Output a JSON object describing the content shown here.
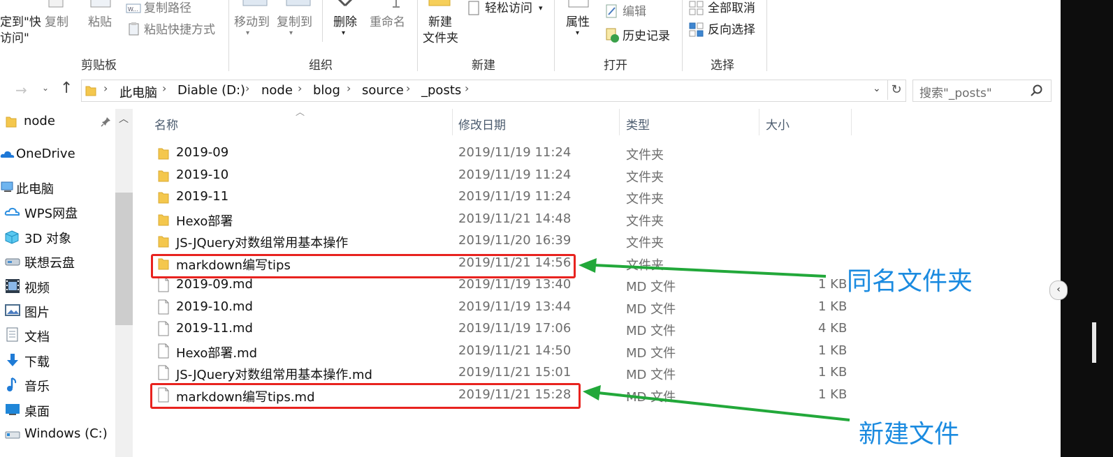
{
  "ribbon": {
    "pin_label_line1": "定到\"快",
    "pin_label_line2": "访问\"",
    "copy": "复制",
    "paste": "粘贴",
    "copy_path": "复制路径",
    "paste_shortcut": "粘贴快捷方式",
    "move_to": "移动到",
    "copy_to": "复制到",
    "delete": "删除",
    "rename": "重命名",
    "new_folder_line1": "新建",
    "new_folder_line2": "文件夹",
    "easy_access": "轻松访问",
    "properties": "属性",
    "edit": "编辑",
    "history": "历史记录",
    "select_all_none": "全部取消",
    "invert_selection": "反向选择",
    "groups": {
      "clipboard": "剪贴板",
      "organize": "组织",
      "new": "新建",
      "open": "打开",
      "select": "选择"
    }
  },
  "address": {
    "crumbs": [
      "此电脑",
      "Diable (D:)",
      "node",
      "blog",
      "source",
      "_posts"
    ],
    "search_placeholder": "搜索\"_posts\""
  },
  "nav": {
    "items": [
      {
        "label": "node",
        "icon": "folder-icon",
        "color": "#e8b93c"
      },
      {
        "label": "OneDrive",
        "icon": "cloud-icon",
        "color": "#1e78d7"
      },
      {
        "label": "此电脑",
        "icon": "computer-icon",
        "color": "#3a86c8"
      },
      {
        "label": "WPS网盘",
        "icon": "cloud-outline-icon",
        "color": "#2d8fe0"
      },
      {
        "label": "3D 对象",
        "icon": "cube-icon",
        "color": "#2aa6d8"
      },
      {
        "label": "联想云盘",
        "icon": "drive-icon",
        "color": "#5c6b7a"
      },
      {
        "label": "视频",
        "icon": "film-icon",
        "color": "#334"
      },
      {
        "label": "图片",
        "icon": "picture-icon",
        "color": "#4a6c8c"
      },
      {
        "label": "文档",
        "icon": "document-icon",
        "color": "#6b7b8b"
      },
      {
        "label": "下载",
        "icon": "download-icon",
        "color": "#1f7bd6"
      },
      {
        "label": "音乐",
        "icon": "music-icon",
        "color": "#1f7bd6"
      },
      {
        "label": "桌面",
        "icon": "desktop-icon",
        "color": "#1f86d8"
      },
      {
        "label": "Windows (C:)",
        "icon": "disk-icon",
        "color": "#7a8a9a"
      }
    ]
  },
  "list": {
    "headers": {
      "name": "名称",
      "date": "修改日期",
      "type": "类型",
      "size": "大小"
    },
    "rows": [
      {
        "name": "2019-09",
        "date": "2019/11/19 11:24",
        "type": "文件夹",
        "size": "",
        "kind": "folder"
      },
      {
        "name": "2019-10",
        "date": "2019/11/19 11:24",
        "type": "文件夹",
        "size": "",
        "kind": "folder"
      },
      {
        "name": "2019-11",
        "date": "2019/11/19 11:24",
        "type": "文件夹",
        "size": "",
        "kind": "folder"
      },
      {
        "name": "Hexo部署",
        "date": "2019/11/21 14:48",
        "type": "文件夹",
        "size": "",
        "kind": "folder"
      },
      {
        "name": "JS-JQuery对数组常用基本操作",
        "date": "2019/11/20 16:39",
        "type": "文件夹",
        "size": "",
        "kind": "folder"
      },
      {
        "name": "markdown编写tips",
        "date": "2019/11/21 14:56",
        "type": "文件夹",
        "size": "",
        "kind": "folder"
      },
      {
        "name": "2019-09.md",
        "date": "2019/11/19 13:40",
        "type": "MD 文件",
        "size": "1 KB",
        "kind": "file"
      },
      {
        "name": "2019-10.md",
        "date": "2019/11/19 13:44",
        "type": "MD 文件",
        "size": "1 KB",
        "kind": "file"
      },
      {
        "name": "2019-11.md",
        "date": "2019/11/19 17:06",
        "type": "MD 文件",
        "size": "4 KB",
        "kind": "file"
      },
      {
        "name": "Hexo部署.md",
        "date": "2019/11/21 14:50",
        "type": "MD 文件",
        "size": "1 KB",
        "kind": "file"
      },
      {
        "name": "JS-JQuery对数组常用基本操作.md",
        "date": "2019/11/21 15:01",
        "type": "MD 文件",
        "size": "1 KB",
        "kind": "file"
      },
      {
        "name": "markdown编写tips.md",
        "date": "2019/11/21 15:28",
        "type": "MD 文件",
        "size": "1 KB",
        "kind": "file"
      }
    ]
  },
  "annotations": {
    "same_name_folder": "同名文件夹",
    "new_file": "新建文件",
    "box_color": "#e8231f",
    "arrow_color": "#22a83a",
    "text_color": "#1b8be0"
  }
}
